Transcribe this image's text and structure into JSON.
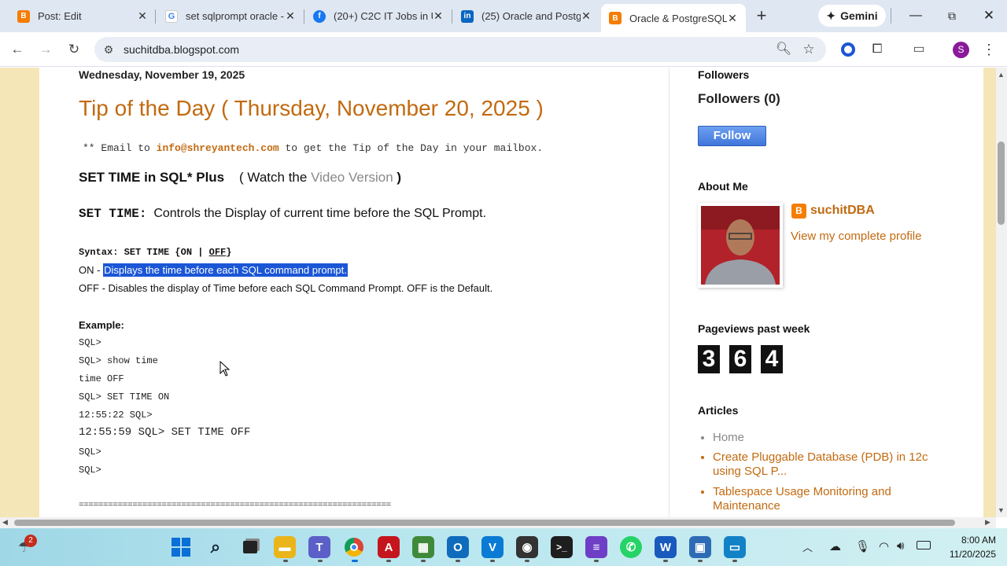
{
  "browser": {
    "tabs": [
      {
        "title": "Post: Edit"
      },
      {
        "title": "set sqlprompt oracle -"
      },
      {
        "title": "(20+) C2C IT Jobs in U"
      },
      {
        "title": "(25) Oracle and Postgr"
      },
      {
        "title": "Oracle & PostgreSQL"
      }
    ],
    "gemini_label": "Gemini",
    "url": "suchitdba.blogspot.com",
    "profile_initial": "S"
  },
  "post": {
    "date": "Wednesday, November 19, 2025",
    "title": "Tip of the Day ( Thursday, November 20, 2025 )",
    "email_prefix": "** Email to",
    "email": "info@shreyantech.com",
    "email_suffix": "to get the Tip of the Day in your mailbox.",
    "heading": "SET TIME in SQL* Plus",
    "watch_open": "( Watch the",
    "video_link": "Video Version",
    "watch_close": ")",
    "set_time_label": "SET TIME:",
    "set_time_desc": "Controls the Display of current time before the SQL Prompt.",
    "syntax_prefix": "Syntax: SET TIME {ON |",
    "syntax_off": "OFF",
    "syntax_suffix": "}",
    "on_label": "ON -",
    "on_desc": "Displays the time before each SQL command prompt.",
    "off_line": "OFF - Disables the display of Time before each SQL Command Prompt. OFF is the Default.",
    "example_label": "Example:",
    "code_lines": [
      "SQL>",
      "SQL> show time",
      "time OFF",
      "SQL> SET TIME ON",
      "12:55:22 SQL>",
      "12:55:59 SQL> SET TIME OFF",
      "SQL>",
      "SQL>"
    ],
    "divider": "================================================================"
  },
  "sidebar": {
    "followers_heading": "Followers",
    "followers_count": "Followers (0)",
    "follow_button": "Follow",
    "about_heading": "About Me",
    "author_name": "suchitDBA",
    "profile_link": "View my complete profile",
    "pageviews_heading": "Pageviews past week",
    "pageviews_digits": [
      "3",
      "6",
      "4"
    ],
    "articles_heading": "Articles",
    "articles": [
      "Home",
      "Create Pluggable Database (PDB) in 12c using SQL P...",
      "Tablespace Usage Monitoring and Maintenance"
    ]
  },
  "taskbar": {
    "weather_badge": "2",
    "time": "8:00 AM",
    "date": "11/20/2025"
  },
  "colors": {
    "accent_orange": "#c26a10",
    "selection_blue": "#1a56d6",
    "follow_blue": "#4a86e8",
    "page_bg": "#f5e6b8"
  }
}
